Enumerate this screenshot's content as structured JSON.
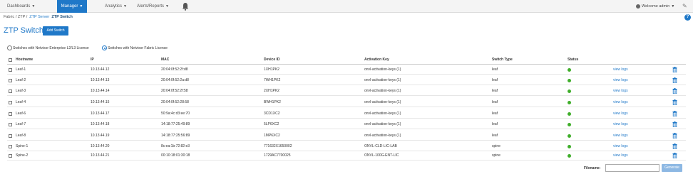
{
  "nav": {
    "items": [
      {
        "label": "Dashboards",
        "active": false
      },
      {
        "label": "Manager",
        "active": true
      },
      {
        "label": "Analytics",
        "active": false
      },
      {
        "label": "Alerts/Reports",
        "active": false
      }
    ],
    "user_label": "Welcome admin",
    "accent": "#1f78c8"
  },
  "breadcrumb": {
    "fabric": "Fabric",
    "sep1": "/",
    "ztp": "ZTP",
    "sep2": "/",
    "server": "ZTP Server",
    "current": "ZTP Switch"
  },
  "page": {
    "title": "ZTP Switch",
    "add_label": "Add Switch"
  },
  "license": {
    "option1": "Switches with Netvisor Enterprise L2/L3 License",
    "option2": "Switches with Netvisor Fabric License",
    "selected": 2
  },
  "table": {
    "headers": {
      "hostname": "Hostname",
      "ip": "IP",
      "mac": "MAC",
      "device_id": "Device ID",
      "activation_key": "Activation Key",
      "switch_type": "Switch Type",
      "status": "Status"
    },
    "rows": [
      {
        "hostname": "Leaf-1",
        "ip": "10.13.44.12",
        "mac": "20:04:0f:52:2f:d8",
        "device_id": "1XH1PK2",
        "key": "onvl-activation-keys (1)",
        "type": "leaf",
        "logs": "view logs"
      },
      {
        "hostname": "Leaf-2",
        "ip": "10.13.44.13",
        "mac": "20:04:0f:52:2a:d8",
        "device_id": "7WH1PK2",
        "key": "onvl-activation-keys (1)",
        "type": "leaf",
        "logs": "view logs"
      },
      {
        "hostname": "Leaf-3",
        "ip": "10.13.44.14",
        "mac": "20:04:0f:52:2f:58",
        "device_id": "2XH1PK2",
        "key": "onvl-activation-keys (1)",
        "type": "leaf",
        "logs": "view logs"
      },
      {
        "hostname": "Leaf-4",
        "ip": "10.13.44.15",
        "mac": "20:04:0f:52:28:58",
        "device_id": "BWH1PK2",
        "key": "onvl-activation-keys (1)",
        "type": "leaf",
        "logs": "view logs"
      },
      {
        "hostname": "Leaf-6",
        "ip": "10.13.44.17",
        "mac": "50:9a:4c:d3:ee:70",
        "device_id": "3CD1XC2",
        "key": "onvl-activation-keys (1)",
        "type": "leaf",
        "logs": "view logs"
      },
      {
        "hostname": "Leaf-7",
        "ip": "10.13.44.18",
        "mac": "14:18:77:25:49:89",
        "device_id": "5LP6XC2",
        "key": "onvl-activation-keys (1)",
        "type": "leaf",
        "logs": "view logs"
      },
      {
        "hostname": "Leaf-8",
        "ip": "10.13.44.19",
        "mac": "14:18:77:25:56:89",
        "device_id": "1MP6XC2",
        "key": "onvl-activation-keys (1)",
        "type": "leaf",
        "logs": "view logs"
      },
      {
        "hostname": "Spine-1",
        "ip": "10.13.44.20",
        "mac": "8c:ea:1b:72:82:e3",
        "device_id": "771632X1650002",
        "key": "ONVL-CLD-LIC-LAB",
        "type": "spine",
        "logs": "view logs"
      },
      {
        "hostname": "Spine-2",
        "ip": "10.13.44.21",
        "mac": "00:10:18:01:30:18",
        "device_id": "1729AC7700025",
        "key": "ONVL-100G-ENT-LIC",
        "type": "spine",
        "logs": "view logs"
      }
    ],
    "status_color": "#3fae2a"
  },
  "footer": {
    "filename_label": "Filename:",
    "filename_value": "",
    "generate_label": "Generate"
  }
}
